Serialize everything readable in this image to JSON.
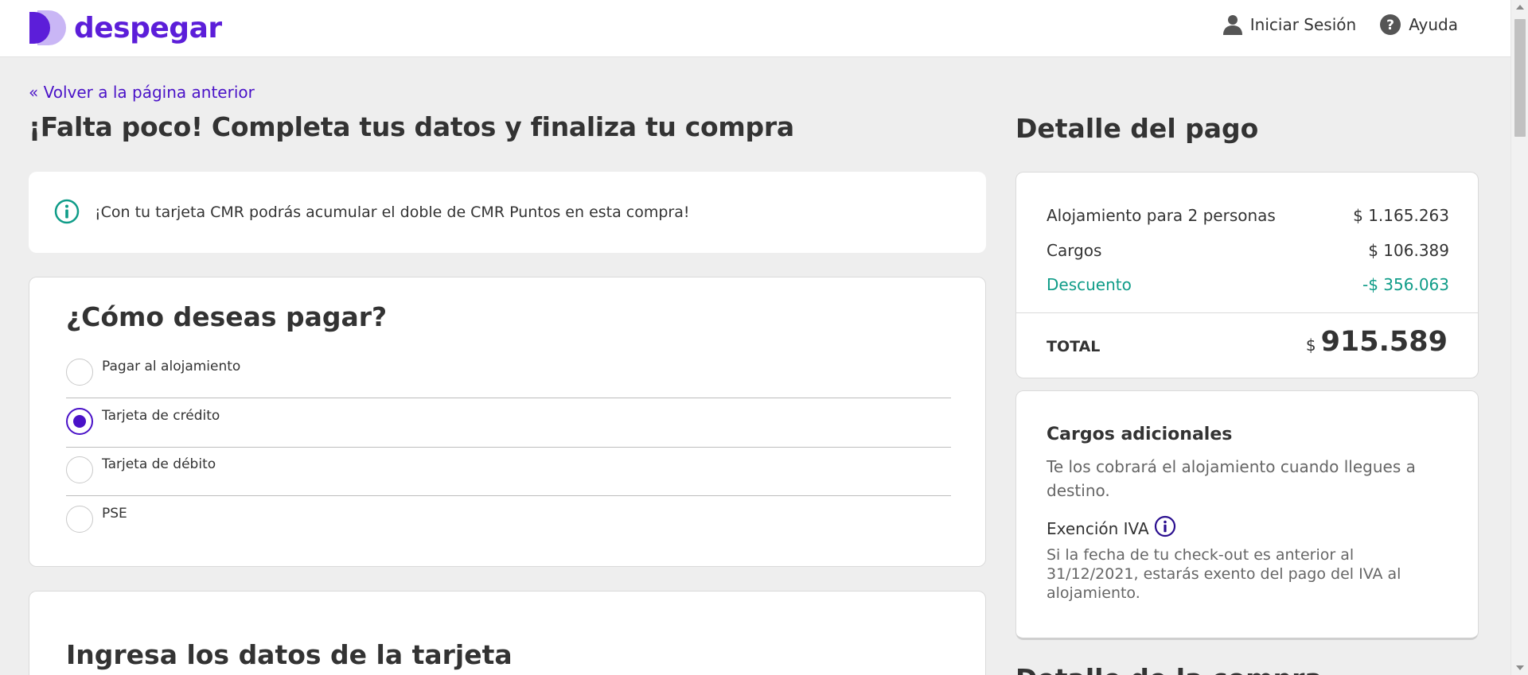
{
  "header": {
    "logo_text": "despegar",
    "login_label": "Iniciar Sesión",
    "help_label": "Ayuda",
    "brand_color": "#5c1ed9"
  },
  "main": {
    "back_link": "« Volver a la página anterior",
    "title": "¡Falta poco! Completa tus datos y finaliza tu compra",
    "info_banner": "¡Con tu tarjeta CMR podrás acumular el doble de CMR Puntos en esta compra!",
    "payment": {
      "title": "¿Cómo deseas pagar?",
      "options": [
        {
          "label": "Pagar al alojamiento",
          "selected": false
        },
        {
          "label": "Tarjeta de crédito",
          "selected": true
        },
        {
          "label": "Tarjeta de débito",
          "selected": false
        },
        {
          "label": "PSE",
          "selected": false
        }
      ]
    },
    "card_data_title": "Ingresa los datos de la tarjeta"
  },
  "summary": {
    "title": "Detalle del pago",
    "rows": [
      {
        "label": "Alojamiento para 2 personas",
        "amount": "$ 1.165.263"
      },
      {
        "label": "Cargos",
        "amount": "$ 106.389"
      },
      {
        "label": "Descuento",
        "amount": "-$ 356.063"
      }
    ],
    "total_label": "TOTAL",
    "total_currency": "$",
    "total_value": "915.589",
    "discount_color": "#0f9c88"
  },
  "extra": {
    "title": "Cargos adicionales",
    "text": "Te los cobrará el alojamiento cuando llegues a destino.",
    "iva_label": "Exención IVA",
    "iva_text": "Si la fecha de tu check-out es anterior al 31/12/2021, estarás exento del pago del IVA al alojamiento."
  },
  "next_section_title": "Detalle de la compra"
}
